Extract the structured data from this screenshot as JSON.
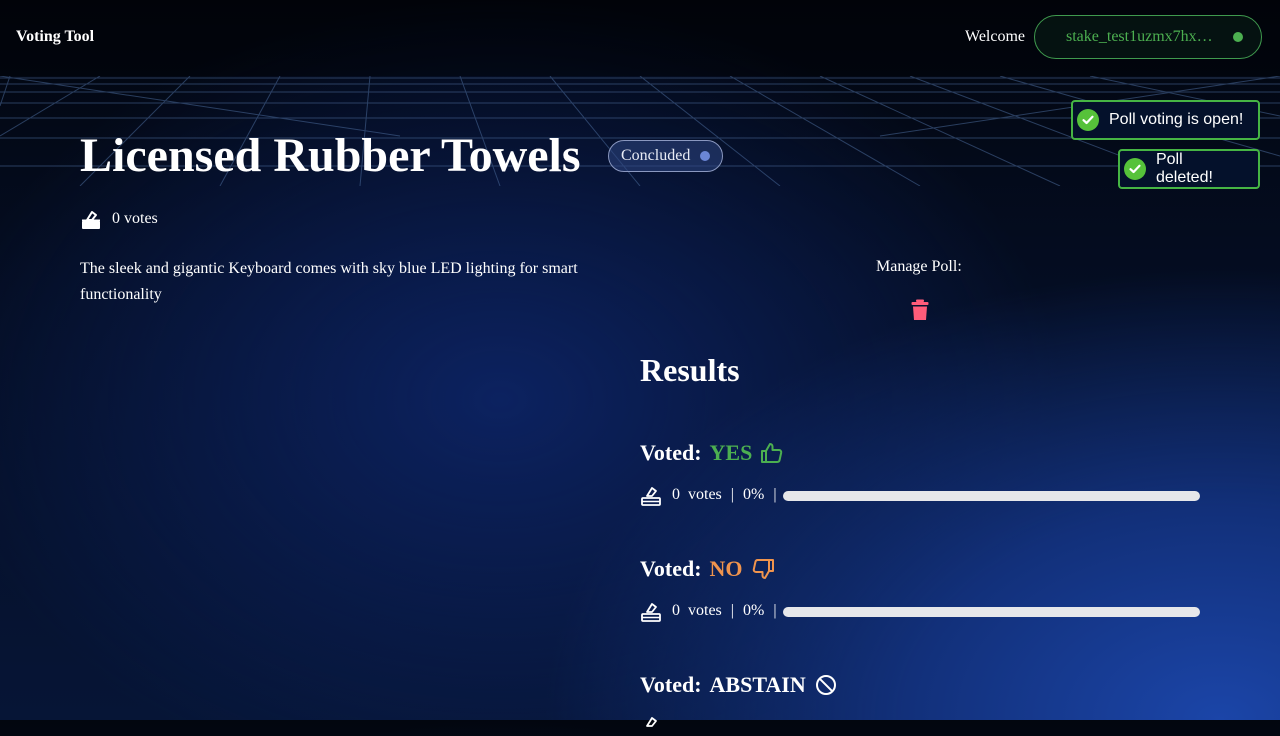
{
  "header": {
    "app_title": "Voting Tool",
    "welcome": "Welcome",
    "wallet_address": "stake_test1uzmx7hx…",
    "wallet_status_color": "#4caf50"
  },
  "toasts": [
    {
      "text": "Poll voting is open!",
      "icon": "check-circle-icon"
    },
    {
      "text": "Poll deleted!",
      "icon": "check-circle-icon"
    }
  ],
  "poll": {
    "title": "Licensed Rubber Towels",
    "status": "Concluded",
    "total_votes": "0 votes",
    "description": "The sleek and gigantic Keyboard comes with sky blue LED lighting for smart functionality"
  },
  "manage": {
    "label": "Manage Poll:",
    "delete_icon": "trash-icon"
  },
  "results": {
    "title": "Results",
    "voted_label": "Voted:",
    "votes_word": "votes",
    "options": [
      {
        "choice": "YES",
        "icon": "thumbs-up-icon",
        "color": "#4caf50",
        "count": "0",
        "percent": "0%",
        "fraction": 0
      },
      {
        "choice": "NO",
        "icon": "thumbs-down-icon",
        "color": "#f0944d",
        "count": "0",
        "percent": "0%",
        "fraction": 0
      },
      {
        "choice": "ABSTAIN",
        "icon": "abstain-icon",
        "color": "#ffffff"
      }
    ]
  }
}
